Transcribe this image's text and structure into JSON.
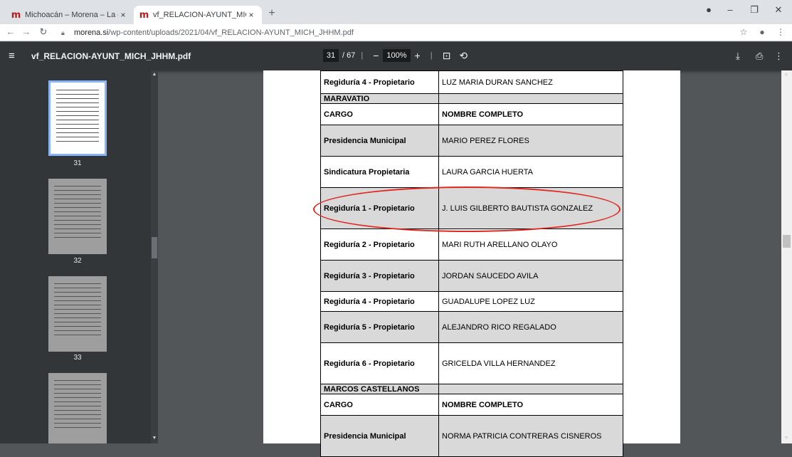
{
  "browser": {
    "tabs": [
      {
        "label": "Michoacán – Morena – La espera",
        "close": "×"
      },
      {
        "label": "vf_RELACION-AYUNT_MICH_JHH",
        "close": "×"
      }
    ],
    "new_tab": "+",
    "url_host": "morena.si",
    "url_path": "/wp-content/uploads/2021/04/vf_RELACION-AYUNT_MICH_JHHM.pdf"
  },
  "pdf_toolbar": {
    "title": "vf_RELACION-AYUNT_MICH_JHHM.pdf",
    "current_page": "31",
    "total_pages": "/ 67",
    "zoom": "100%"
  },
  "sidebar": {
    "pages": [
      "31",
      "32",
      "33"
    ]
  },
  "table": {
    "rows": [
      {
        "cargo": "Regiduría 4 - Propietario",
        "nombre": "LUZ MARIA  DURAN SANCHEZ",
        "style": "plain",
        "h": 32
      },
      {
        "cargo": "MARAVATIO",
        "nombre": "",
        "style": "gray-sec",
        "h": 14
      },
      {
        "cargo": "CARGO",
        "nombre": "NOMBRE COMPLETO",
        "style": "header",
        "h": 30
      },
      {
        "cargo": "Presidencia Municipal",
        "nombre": "MARIO  PEREZ FLORES",
        "style": "gray",
        "h": 44
      },
      {
        "cargo": "Sindicatura Propietaria",
        "nombre": "LAURA GARCIA HUERTA",
        "style": "plain",
        "h": 44
      },
      {
        "cargo": "Regiduría 1 - Propietario",
        "nombre": "J. LUIS GILBERTO BAUTISTA  GONZALEZ",
        "style": "gray",
        "h": 58
      },
      {
        "cargo": "Regiduría 2 - Propietario",
        "nombre": "MARI RUTH ARELLANO OLAYO",
        "style": "plain",
        "h": 44
      },
      {
        "cargo": "Regiduría 3 - Propietario",
        "nombre": "JORDAN SAUCEDO AVILA",
        "style": "gray",
        "h": 44
      },
      {
        "cargo": "Regiduría 4 - Propietario",
        "nombre": "GUADALUPE LOPEZ LUZ",
        "style": "plain",
        "h": 28
      },
      {
        "cargo": "Regiduría 5 - Propietario",
        "nombre": "ALEJANDRO RICO REGALADO",
        "style": "gray",
        "h": 44
      },
      {
        "cargo": "Regiduría 6 - Propietario",
        "nombre": "GRICELDA  VILLA HERNANDEZ",
        "style": "plain",
        "h": 58
      },
      {
        "cargo": "MARCOS CASTELLANOS",
        "nombre": "",
        "style": "gray-sec",
        "h": 14
      },
      {
        "cargo": "CARGO",
        "nombre": "NOMBRE COMPLETO",
        "style": "header",
        "h": 30
      },
      {
        "cargo": "Presidencia Municipal",
        "nombre": "NORMA PATRICIA CONTRERAS CISNEROS",
        "style": "gray",
        "h": 58
      }
    ]
  },
  "colors": {
    "highlight_ellipse": "#e0261f",
    "pdf_toolbar": "#323639",
    "viewer_bg": "#525659"
  }
}
